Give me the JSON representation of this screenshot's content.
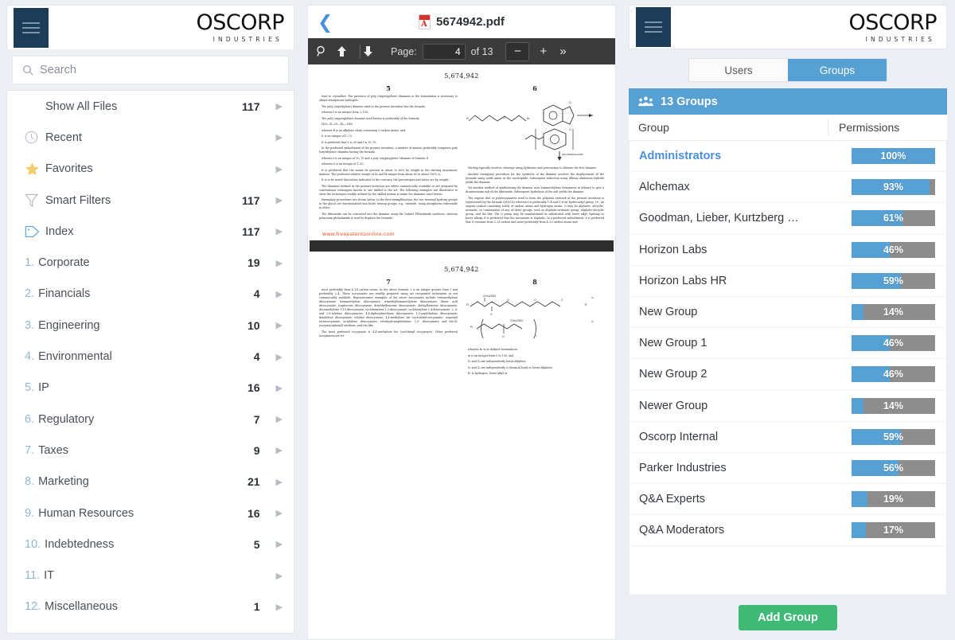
{
  "brand": {
    "name": "OSCORP",
    "tagline": "INDUSTRIES"
  },
  "colors": {
    "navy": "#1d3c58",
    "accent_blue": "#56a0d3",
    "link_blue": "#4a90d9",
    "green": "#3fba76",
    "track_gray": "#8d8d8d",
    "page_bg": "#eceff3"
  },
  "left_panel": {
    "menu_icon": "hamburger-icon",
    "search": {
      "placeholder": "Search",
      "value": "",
      "icon": "search-icon"
    },
    "items": [
      {
        "label": "Show All Files",
        "count": "117",
        "icon": "",
        "arrow": "▶"
      },
      {
        "label": "Recent",
        "count": "",
        "icon": "clock-icon",
        "arrow": "▶"
      },
      {
        "label": "Favorites",
        "count": "",
        "icon": "star-icon",
        "arrow": "▶"
      },
      {
        "label": "Smart Filters",
        "count": "117",
        "icon": "funnel-icon",
        "arrow": "▶"
      },
      {
        "label": "Index",
        "count": "117",
        "icon": "tag-icon",
        "arrow": "▶"
      }
    ],
    "index_items": [
      {
        "num": "1.",
        "label": "Corporate",
        "count": "19",
        "arrow": "▶"
      },
      {
        "num": "2.",
        "label": "Financials",
        "count": "4",
        "arrow": "▶"
      },
      {
        "num": "3.",
        "label": "Engineering",
        "count": "10",
        "arrow": "▶"
      },
      {
        "num": "4.",
        "label": "Environmental",
        "count": "4",
        "arrow": "▶"
      },
      {
        "num": "5.",
        "label": "IP",
        "count": "16",
        "arrow": "▶"
      },
      {
        "num": "6.",
        "label": "Regulatory",
        "count": "7",
        "arrow": "▶"
      },
      {
        "num": "7.",
        "label": "Taxes",
        "count": "9",
        "arrow": "▶"
      },
      {
        "num": "8.",
        "label": "Marketing",
        "count": "21",
        "arrow": "▶"
      },
      {
        "num": "9.",
        "label": "Human Resources",
        "count": "16",
        "arrow": "▶"
      },
      {
        "num": "10.",
        "label": "Indebtedness",
        "count": "5",
        "arrow": "▶"
      },
      {
        "num": "11.",
        "label": "IT",
        "count": "",
        "arrow": "▶"
      },
      {
        "num": "12.",
        "label": "Miscellaneous",
        "count": "1",
        "arrow": "▶"
      }
    ]
  },
  "pdf_panel": {
    "back_icon": "chevron-left-icon",
    "file_icon": "pdf-file-icon",
    "filename": "5674942.pdf",
    "toolbar": {
      "search_icon": "magnifier-icon",
      "prev_icon": "arrow-up-icon",
      "next_icon": "arrow-down-icon",
      "page_label": "Page:",
      "page_value": "4",
      "page_total": "of 13",
      "zoom_out": "−",
      "zoom_in": "+",
      "more_icon": "chevrons-right-icon"
    },
    "document": {
      "patent_number": "5,674,942",
      "page_columns_a": [
        "5",
        "6"
      ],
      "page_columns_b": [
        "7",
        "8"
      ],
      "watermark": "www.freepatentsonline.com",
      "col5_paragraphs": [
        "tend to crystallize. The presence of poly (oxypropylene) diamines in the formulation is necessary to obtain transparent hydrogels.",
        "The poly (oxyethylene) diamine used in the present invention has the formula",
        "wherein f is an integer from 2–150.",
        "The poly (oxypropylene) diamine used herein is preferably of the formula",
        "H₂N—R—(O—R)ₙ—NH₂",
        "wherein R is an alkylene chain containing 3 carbon atoms, and",
        "f₁ is an integer of 1–75.",
        "It is preferred that f₁ is 30 and f is 30–70.",
        "In the preferred embodiment of the present invention, a mixture of amines preferably comprises poly (oxyethylene) diamine having the formula",
        "wherein f is an integer of 30–70 and a poly (oxypropylene) diamine of formula II",
        "wherein f₁ is an integer of 1–50.",
        "It is preferred that the amine be present in about 20–60% by weight in the starting monomeric mixture. The preferred relative weight of IA and IB ranges from about 60 to about 100% A.",
        "It is to be noted that unless indicated to the contrary, the percentages and ratios are by weight.",
        "The diamines utilized in the present invention are either commercially available or are prepared by conventional techniques known to one skilled in the art. The following examples are illustrative to show the techniques readily utilized by the skilled artisan to make the diamines used herein.",
        "Exemplary procedures are shown below. In the first exemplification, the two terminal hydroxy groups in the glycol are functionalized into facile leaving groups, e.g., bromide, using phosphorus tribromide in ether.",
        "The dibromide can be converted into the diamine using the Gabriel Phthalimide synthesis, wherein potassium phthalamide is used to displace the bromide."
      ],
      "col6_paragraphs": [
        "Workup typically involves cleavage using hydrazine and protonation to liberate the free diamine.",
        "Another exemplary procedure for the synthesis of the diamine involves the displacement of the bromide using azide anion as the nucleophile. Subsequent reduction using lithium aluminum hydride yields the diamine.",
        "Yet another method of synthesizing the diamine uses hexamethylene tetraamine in ethanol to give a di-ammonium salt of the dibromide. Subsequent hydrolysis of the salt yields the diamine.",
        "The organic diol or polyisocyanates used to form the polyurea network of the present invention is represented by the formula Q(NCO)z wherein z is preferably 1–4 and Q is an hydrocarbyl group, i.e., an organic radical consisting solely of carbon atoms and hydrogen atoms. Q may be aliphatic, alicyclic, aromatic, or combination of any of these groups, such as aliphatic-aromatic group, aliphatic-alicyclic group, and the like. The Q group may be unsubstituted or substituted with lower alkyl, hydroxy or lower alkoxy. It is preferred that the isocyanate is aliphatic. In a preferred embodiment, it is preferred that Q contains from 3–26 carbon and more preferably from 4–20 carbon atoms and"
      ],
      "col7_paragraphs": [
        "most preferably from 6–14 carbon atoms. In the above formula, t is an integer greater than 1 and preferably 2–4. These isocyanates are readily prepared using art recognized techniques or are commercially available. Representative examples of the above isocyanates include tetramethylene diisocyanate; hexamethylene diisocyanate; trimethylhexamethylene diisocyanate; dimer acid diisocyanate; isophorone diisocyanate; dimethylbenzene diisocyanate; diethylbenzene diisocyanate; decamethylene 1,10-diisocyanate; cyclohexylene 1,2-diisocyanate; cyclohexylene 1,4-diisocyanate; 2, 4-and 2-6-tolylene diisocyanates; 4,4-diphenylmethane diisocyanate; 1,5-naphthalene diisocyanate; dianilidine diisocyanate; tolidine diisocyanate; 4,4-methylene bis (cyclohexyl-isocyanate); isopentyl tetraisocyanate; m-xylylene diisocyanate; tetrahydronaphthalene -1,5- diisocyanate and bis-(4-isocyanatophenyl) methane, and the like.",
        "The most preferred isocyanate is 4,4'-methylene bis (cyclohexyl isocyanate). Other preferred isocyanates are tri-"
      ],
      "col8_paragraphs": [
        "wherein R₄ is as defined hereinabove;",
        "m is an integer from 0 to 150; and",
        "Z₃ and Z₄ are independently lower alkylene;",
        "Z₅ and Z₆ are independently a chemical bond or lower alkylene;",
        "R₇ is hydrogen, lower alkyl or"
      ]
    }
  },
  "right_panel": {
    "menu_icon": "hamburger-icon",
    "tabs": [
      {
        "label": "Users",
        "active": false
      },
      {
        "label": "Groups",
        "active": true
      }
    ],
    "groups_header": {
      "icon": "people-group-icon",
      "title": "13 Groups"
    },
    "columns": [
      "Group",
      "Permissions"
    ],
    "rows": [
      {
        "name": "Administrators",
        "percent": 100,
        "label": "100%",
        "selected": true
      },
      {
        "name": "Alchemax",
        "percent": 93,
        "label": "93%",
        "selected": false
      },
      {
        "name": "Goodman, Lieber, Kurtzberg …",
        "percent": 61,
        "label": "61%",
        "selected": false
      },
      {
        "name": "Horizon Labs",
        "percent": 46,
        "label": "46%",
        "selected": false
      },
      {
        "name": "Horizon Labs HR",
        "percent": 59,
        "label": "59%",
        "selected": false
      },
      {
        "name": "New Group",
        "percent": 14,
        "label": "14%",
        "selected": false
      },
      {
        "name": "New Group 1",
        "percent": 46,
        "label": "46%",
        "selected": false
      },
      {
        "name": "New Group 2",
        "percent": 46,
        "label": "46%",
        "selected": false
      },
      {
        "name": "Newer Group",
        "percent": 14,
        "label": "14%",
        "selected": false
      },
      {
        "name": "Oscorp Internal",
        "percent": 59,
        "label": "59%",
        "selected": false
      },
      {
        "name": "Parker Industries",
        "percent": 56,
        "label": "56%",
        "selected": false
      },
      {
        "name": "Q&A Experts",
        "percent": 19,
        "label": "19%",
        "selected": false
      },
      {
        "name": "Q&A Moderators",
        "percent": 17,
        "label": "17%",
        "selected": false
      }
    ],
    "add_button": "Add Group"
  }
}
